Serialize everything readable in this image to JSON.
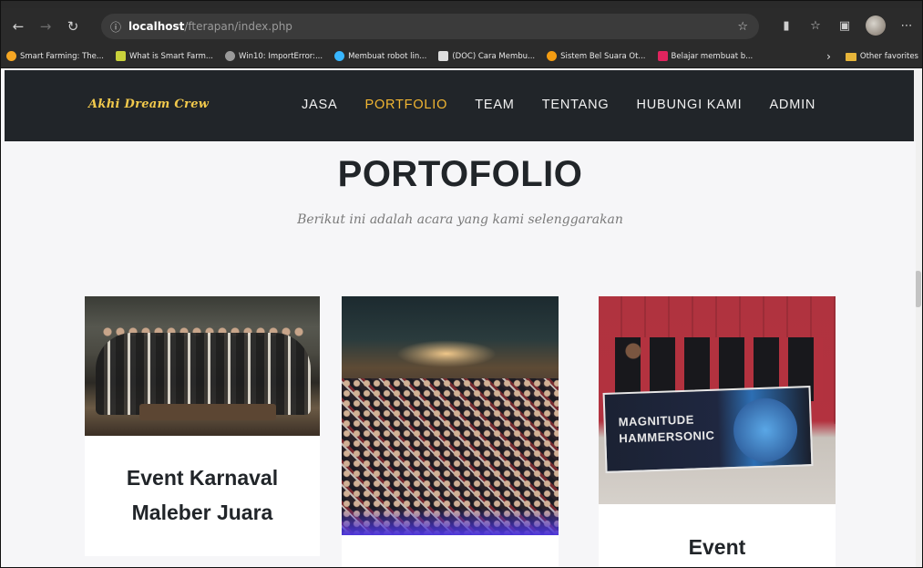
{
  "browser": {
    "url_host": "localhost",
    "url_path": "/fterapan/index.php",
    "bookmarks": [
      {
        "label": "Smart Farming: The...",
        "color": "#f5a623"
      },
      {
        "label": "What is Smart Farm...",
        "color": "#c9d13b"
      },
      {
        "label": "Win10: ImportError:...",
        "color": "#9a9a9a"
      },
      {
        "label": "Membuat robot lin...",
        "color": "#38b6ff"
      },
      {
        "label": "(DOC) Cara Membu...",
        "color": "#dddddd"
      },
      {
        "label": "Sistem Bel Suara Ot...",
        "color": "#f39c12"
      },
      {
        "label": "Belajar membuat b...",
        "color": "#e0245e"
      }
    ],
    "other_favorites": "Other favorites"
  },
  "site": {
    "logo": "Akhi Dream Crew",
    "menu": [
      {
        "label": "JASA",
        "active": false
      },
      {
        "label": "PORTFOLIO",
        "active": true
      },
      {
        "label": "TEAM",
        "active": false
      },
      {
        "label": "TENTANG",
        "active": false
      },
      {
        "label": "HUBUNGI KAMI",
        "active": false
      },
      {
        "label": "ADMIN",
        "active": false
      }
    ],
    "accent": "#f2b632",
    "nav_bg": "#212529"
  },
  "portfolio": {
    "title": "PORTOFOLIO",
    "subtitle": "Berikut ini adalah acara yang kami selenggarakan",
    "cards": [
      {
        "title_line1": "Event Karnaval",
        "title_line2": "Maleber Juara"
      },
      {
        "title_line1": "",
        "title_line2": ""
      },
      {
        "title_line1": "Event",
        "title_line2": ""
      }
    ],
    "banner_text_1": "MAGNITUDE",
    "banner_text_2": "HAMMERSONIC"
  }
}
